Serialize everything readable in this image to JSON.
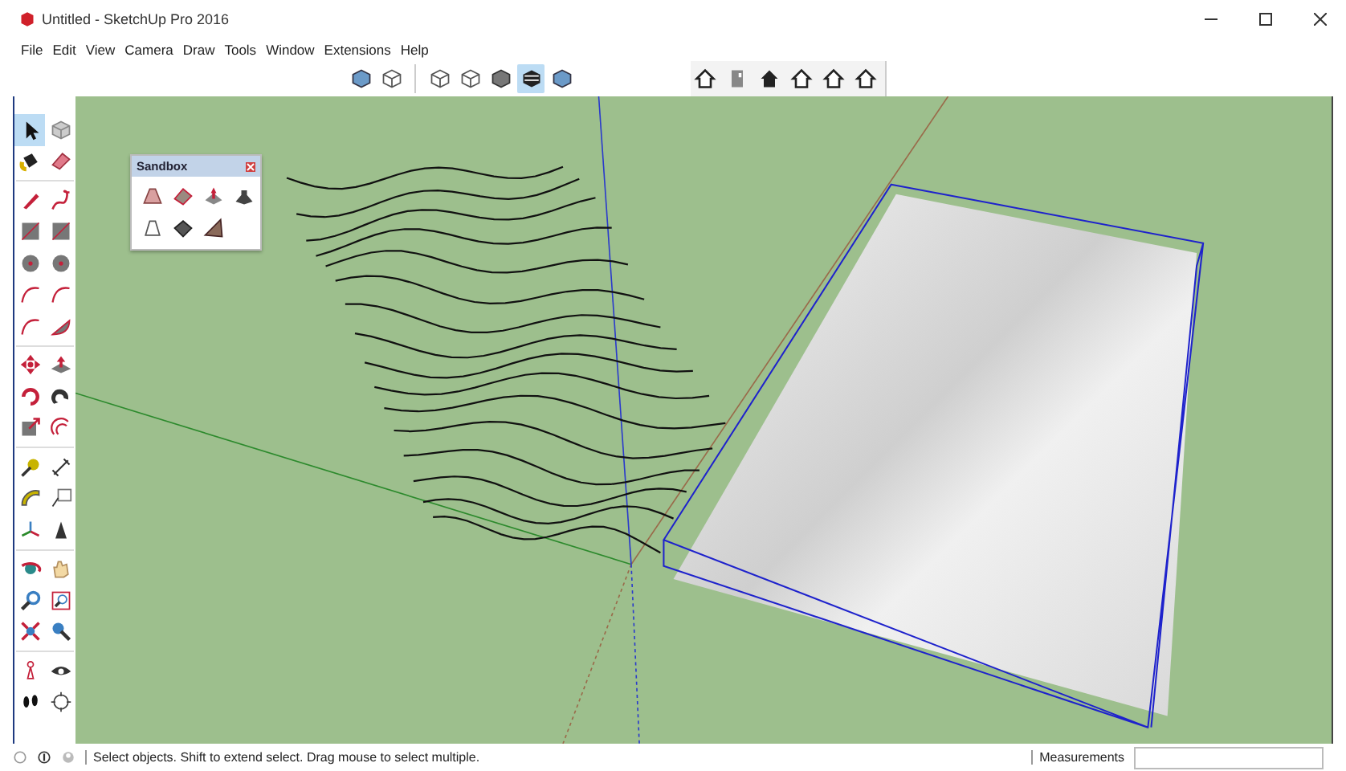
{
  "window": {
    "title": "Untitled - SketchUp Pro 2016"
  },
  "menu": [
    "File",
    "Edit",
    "View",
    "Camera",
    "Draw",
    "Tools",
    "Window",
    "Extensions",
    "Help"
  ],
  "view_toolbar": [
    {
      "selected": false
    },
    {
      "selected": false
    },
    {
      "selected": false
    },
    {
      "selected": false
    },
    {
      "selected": false
    },
    {
      "selected": true
    },
    {
      "selected": false
    }
  ],
  "tool_palette": [
    {
      "selected": true
    },
    {
      "selected": false
    },
    {
      "selected": false
    },
    {
      "selected": false
    },
    {
      "selected": false
    },
    {
      "selected": false
    },
    {
      "selected": false
    },
    {
      "selected": false
    },
    {
      "selected": false
    },
    {
      "selected": false
    },
    {
      "selected": false
    },
    {
      "selected": false
    },
    {
      "selected": false
    },
    {
      "selected": false
    },
    {
      "selected": false
    },
    {
      "selected": false
    },
    {
      "selected": false
    },
    {
      "selected": false
    },
    {
      "selected": false
    },
    {
      "selected": false
    },
    {
      "selected": false
    },
    {
      "selected": false
    },
    {
      "selected": false
    },
    {
      "selected": false
    },
    {
      "selected": false
    },
    {
      "selected": false
    },
    {
      "selected": false
    },
    {
      "selected": false
    },
    {
      "selected": false
    },
    {
      "selected": false
    },
    {
      "selected": false
    },
    {
      "selected": false
    },
    {
      "selected": false
    },
    {
      "selected": false
    },
    {
      "selected": false
    },
    {
      "selected": false
    }
  ],
  "sandbox": {
    "title": "Sandbox"
  },
  "status_bar": {
    "hint": "Select objects. Shift to extend select. Drag mouse to select multiple.",
    "measurements_label": "Measurements"
  }
}
